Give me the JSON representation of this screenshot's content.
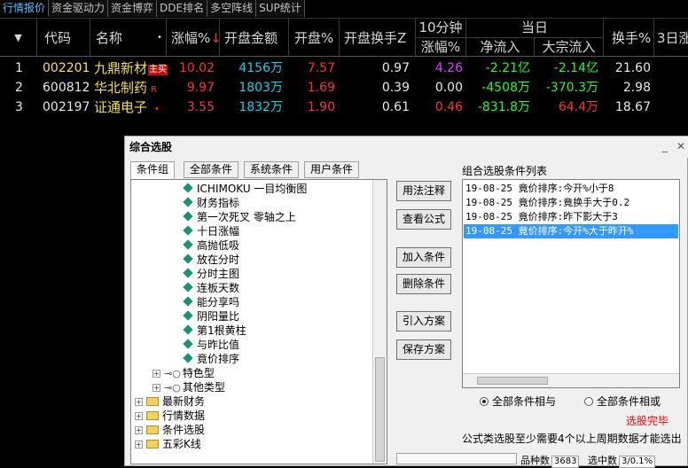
{
  "tabs": [
    "行情报价",
    "资金驱动力",
    "资金博弈",
    "DDE排名",
    "多空阵线",
    "SUP统计"
  ],
  "header": {
    "sort_arrow": "▼",
    "code": "代码",
    "name": "名称",
    "name_dot": "•",
    "change_pct": "涨幅%",
    "change_pct_arrow": "↓",
    "open_amount": "开盘金额",
    "open_pct": "开盘%",
    "open_turnover": "开盘换手Z",
    "ten_min": "10分钟",
    "ten_min_change": "涨幅%",
    "today": "当日",
    "net_inflow": "净流入",
    "block_inflow": "大宗流入",
    "turnover_pct": "换手%",
    "three_day": "3日涨"
  },
  "rows": [
    {
      "idx": "1",
      "code": "002201",
      "name": "九鼎新材",
      "badge": "主买",
      "change": "10.02",
      "amount_num": "4156",
      "amount_unit": "万",
      "open_pct": "7.57",
      "open_turnover": "0.97",
      "ten_min": "4.26",
      "net": "-2.21亿",
      "block": "-2.14亿",
      "turnover": "21.60"
    },
    {
      "idx": "2",
      "code": "600812",
      "name": "华北制药",
      "badge": "R",
      "change": "9.97",
      "amount_num": "1803",
      "amount_unit": "万",
      "open_pct": "1.69",
      "open_turnover": "0.39",
      "ten_min": "0.00",
      "net": "-4508万",
      "block": "-370.3万",
      "turnover": "2.98"
    },
    {
      "idx": "3",
      "code": "002197",
      "name": "证通电子",
      "badge": "•",
      "change": "3.55",
      "amount_num": "1832",
      "amount_unit": "万",
      "open_pct": "1.90",
      "open_turnover": "0.61",
      "ten_min": "0.46",
      "net": "-831.8万",
      "block": "64.4万",
      "turnover": "18.67"
    }
  ],
  "dialog": {
    "title": "综合选股",
    "min": "_",
    "close": "✕",
    "tabs": [
      "条件组",
      "全部条件",
      "系统条件",
      "用户条件"
    ],
    "tree_items": [
      "ICHIMOKU 一目均衡图",
      "财务指标",
      "第一次死叉 零轴之上",
      "十日涨幅",
      "高抛低吸",
      "放在分时",
      "分时主图",
      "连板天数",
      "能分享吗",
      "阴阳量比",
      "第1根黄柱",
      "与昨比值",
      "竟价排序"
    ],
    "tree_groups": [
      "特色型",
      "其他类型"
    ],
    "tree_folders": [
      "最新财务",
      "行情数据",
      "条件选股",
      "五彩K线"
    ],
    "buttons": [
      "用法注释",
      "查看公式",
      "加入条件",
      "删除条件",
      "引入方案",
      "保存方案"
    ],
    "list_title": "组合选股条件列表",
    "conditions": [
      "19-08-25 竟价排序:今开%小于8",
      "19-08-25 竟价排序:竟换手大于0.2",
      "19-08-25 竟价排序:昨下影大于3",
      "19-08-25 竟价排序:今开%大于昨开%"
    ],
    "radio_and": "全部条件相与",
    "radio_or": "全部条件相或",
    "done": "选股完毕",
    "note": "公式类选股至少需要4个以上周期数据才能选出",
    "total_label": "品种数",
    "total_value": "3683",
    "selected_label": "选中数",
    "selected_value": "3/0.1%"
  }
}
